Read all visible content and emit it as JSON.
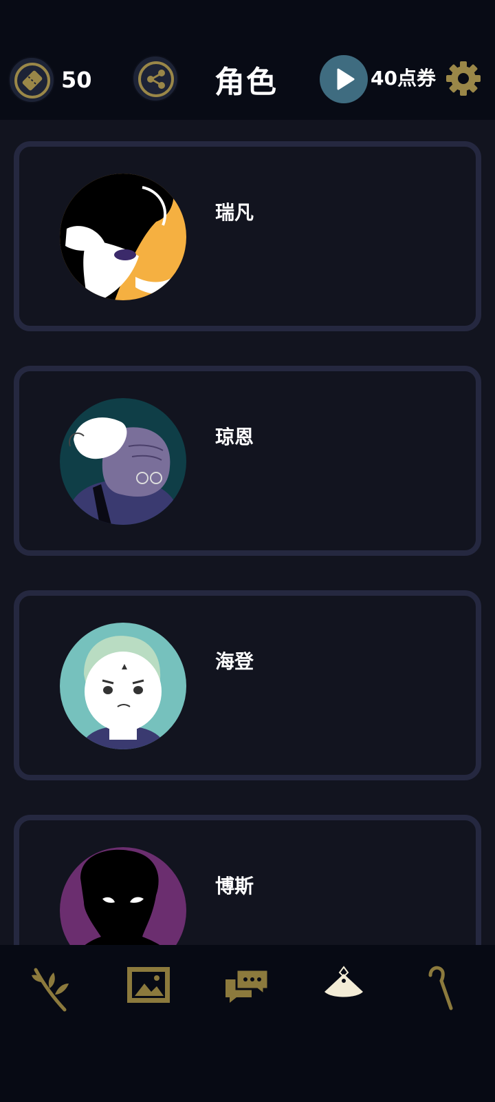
{
  "header": {
    "ticket_count": "50",
    "title": "角色",
    "points_label": "40点券"
  },
  "icons": {
    "ticket": "ticket-icon",
    "share": "share-icon",
    "play": "play-icon",
    "settings": "gear-icon"
  },
  "characters": [
    {
      "name": "瑞凡",
      "avatar_color": "#f5b041"
    },
    {
      "name": "琼恩",
      "avatar_color": "#0f3e47"
    },
    {
      "name": "海登",
      "avatar_color": "#76c1bd"
    },
    {
      "name": "博斯",
      "avatar_color": "#6b2e6f"
    }
  ],
  "bottom_nav": [
    {
      "icon": "branch-icon"
    },
    {
      "icon": "image-icon"
    },
    {
      "icon": "chat-icon"
    },
    {
      "icon": "fan-icon",
      "active": true
    },
    {
      "icon": "cane-icon"
    }
  ],
  "colors": {
    "background": "#12141f",
    "header": "#080b15",
    "accent_gold": "#8c7a3d",
    "card_border": "#252840",
    "play_button": "#3f6c80"
  }
}
